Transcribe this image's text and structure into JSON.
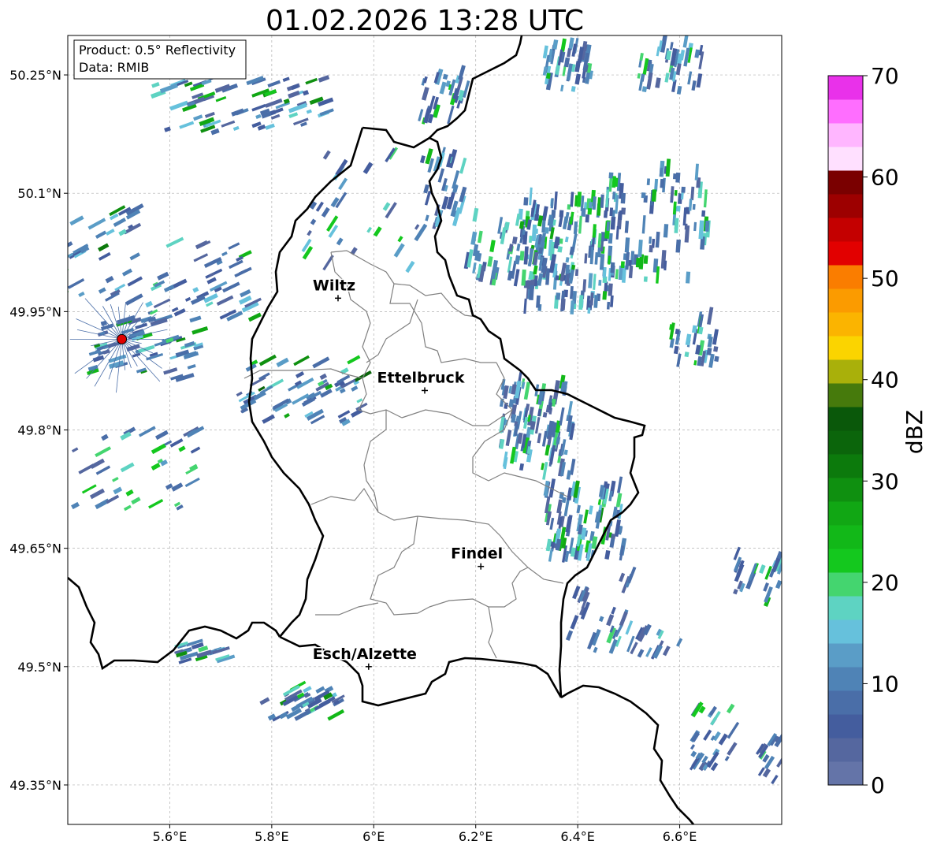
{
  "title": "01.02.2026 13:28 UTC",
  "info_box": {
    "product": "Product: 0.5° Reflectivity",
    "source": "Data: RMIB"
  },
  "map": {
    "lon_range": [
      5.4,
      6.8
    ],
    "lat_range": [
      49.3,
      50.3
    ],
    "lon_ticks": [
      {
        "value": 5.6,
        "label": "5.6°E"
      },
      {
        "value": 5.8,
        "label": "5.8°E"
      },
      {
        "value": 6.0,
        "label": "6°E"
      },
      {
        "value": 6.2,
        "label": "6.2°E"
      },
      {
        "value": 6.4,
        "label": "6.4°E"
      },
      {
        "value": 6.6,
        "label": "6.6°E"
      }
    ],
    "lat_ticks": [
      {
        "value": 50.25,
        "label": "50.25°N"
      },
      {
        "value": 50.1,
        "label": "50.1°N"
      },
      {
        "value": 49.95,
        "label": "49.95°N"
      },
      {
        "value": 49.8,
        "label": "49.8°N"
      },
      {
        "value": 49.65,
        "label": "49.65°N"
      },
      {
        "value": 49.5,
        "label": "49.5°N"
      },
      {
        "value": 49.35,
        "label": "49.35°N"
      }
    ],
    "cities": [
      {
        "name": "Wiltz",
        "lon": 5.93,
        "lat": 49.967
      },
      {
        "name": "Ettelbruck",
        "lon": 6.1,
        "lat": 49.85
      },
      {
        "name": "Findel",
        "lon": 6.21,
        "lat": 49.627
      },
      {
        "name": "Esch/Alzette",
        "lon": 5.99,
        "lat": 49.5
      }
    ],
    "radar_site": {
      "lon": 5.506,
      "lat": 49.915,
      "color": "#e00000"
    }
  },
  "colorbar": {
    "label": "dBZ",
    "min": 0,
    "max": 70,
    "ticks": [
      {
        "value": 0,
        "label": "0"
      },
      {
        "value": 10,
        "label": "10"
      },
      {
        "value": 20,
        "label": "20"
      },
      {
        "value": 30,
        "label": "30"
      },
      {
        "value": 40,
        "label": "40"
      },
      {
        "value": 50,
        "label": "50"
      },
      {
        "value": 60,
        "label": "60"
      },
      {
        "value": 70,
        "label": "70"
      }
    ],
    "colors": [
      "#6474a8",
      "#55679f",
      "#445d9e",
      "#4a6ea8",
      "#4f83b6",
      "#5a9dc7",
      "#66c1dc",
      "#5ed3c2",
      "#44d56f",
      "#14c81e",
      "#12b818",
      "#11a714",
      "#0f9010",
      "#0c7a0c",
      "#0b650b",
      "#0a580a",
      "#467a0c",
      "#a9b00a",
      "#fbd400",
      "#fbb400",
      "#fb9b00",
      "#fa7d00",
      "#e20000",
      "#c40000",
      "#9d0000",
      "#7a0000",
      "#ffe0ff",
      "#ffb6ff",
      "#ff6eff",
      "#e931ea"
    ]
  }
}
